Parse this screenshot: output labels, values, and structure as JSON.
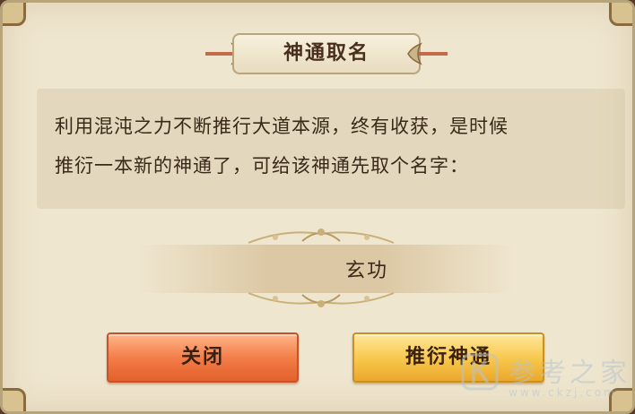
{
  "dialog": {
    "title": "神通取名",
    "message_line_1": "利用混沌之力不断推行大道本源，终有收获，是时候",
    "message_line_2": "推衍一本新的神通了，可给该神通先取个名字：",
    "name_input": {
      "value": "玄功",
      "placeholder": ""
    },
    "buttons": {
      "close_label": "关闭",
      "derive_label": "推衍神通"
    }
  },
  "watermark": {
    "text": "参考之家",
    "url": "www.ckzj.com"
  },
  "colors": {
    "panel_background": "#efe6cf",
    "title_text": "#4a2e1c",
    "body_text": "#3a2818",
    "close_button": "#f27a44",
    "derive_button": "#f7c64a"
  }
}
